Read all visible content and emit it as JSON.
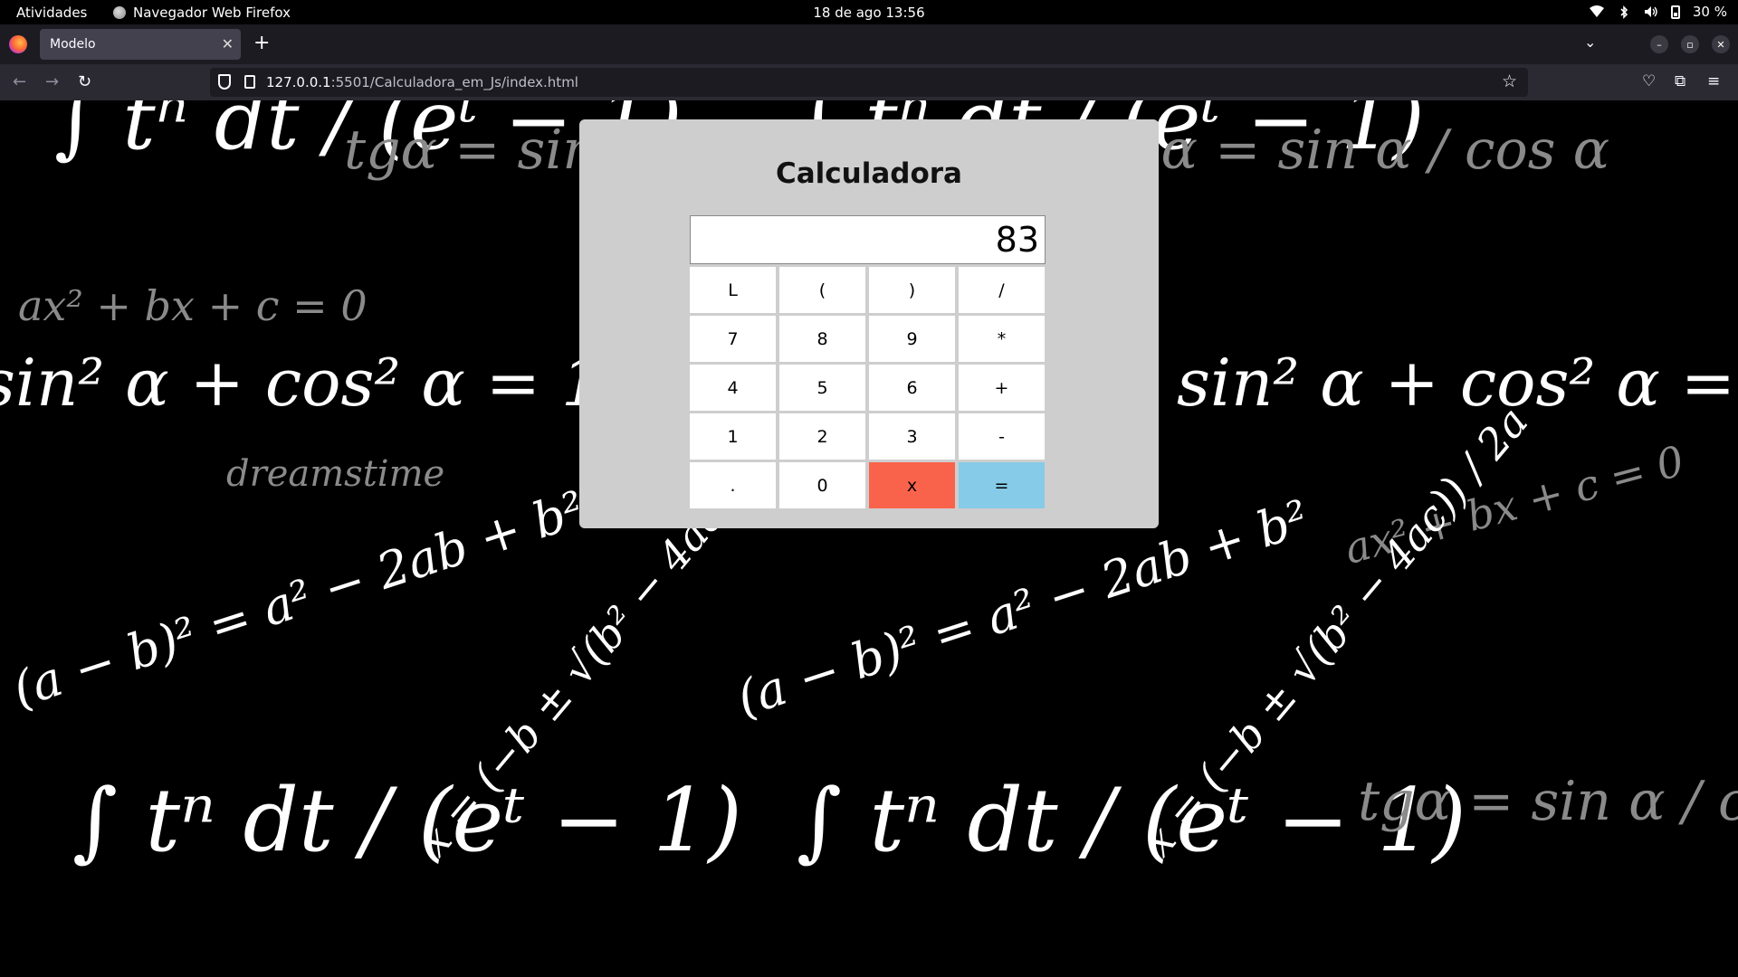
{
  "system": {
    "activities": "Atividades",
    "app_name": "Navegador Web Firefox",
    "clock": "18 de ago  13:56",
    "battery": "30 %"
  },
  "browser": {
    "tab_title": "Modelo",
    "url_host": "127.0.0.1",
    "url_path": ":5501/Calculadora_em_Js/index.html"
  },
  "background_formulas": [
    "∫ tⁿ dt / (eᵗ − 1)",
    "tgα = sin α / cos α",
    "sin² α + cos² α = 1",
    "ax² + bx + c = 0",
    "(a − b)² = a² − 2ab + b²",
    "x = (−b ± √(b² − 4ac)) / 2a",
    "dreamstime"
  ],
  "calculator": {
    "title": "Calculadora",
    "display": "83",
    "keys": [
      {
        "label": "L",
        "type": "normal"
      },
      {
        "label": "(",
        "type": "normal"
      },
      {
        "label": ")",
        "type": "normal"
      },
      {
        "label": "/",
        "type": "normal"
      },
      {
        "label": "7",
        "type": "normal"
      },
      {
        "label": "8",
        "type": "normal"
      },
      {
        "label": "9",
        "type": "normal"
      },
      {
        "label": "*",
        "type": "normal"
      },
      {
        "label": "4",
        "type": "normal"
      },
      {
        "label": "5",
        "type": "normal"
      },
      {
        "label": "6",
        "type": "normal"
      },
      {
        "label": "+",
        "type": "normal"
      },
      {
        "label": "1",
        "type": "normal"
      },
      {
        "label": "2",
        "type": "normal"
      },
      {
        "label": "3",
        "type": "normal"
      },
      {
        "label": "-",
        "type": "normal"
      },
      {
        "label": ".",
        "type": "normal"
      },
      {
        "label": "0",
        "type": "normal"
      },
      {
        "label": "x",
        "type": "clear"
      },
      {
        "label": "=",
        "type": "equals"
      }
    ]
  },
  "colors": {
    "clear_key": "#fa634b",
    "equals_key": "#86cbe7",
    "panel": "#cecece"
  }
}
